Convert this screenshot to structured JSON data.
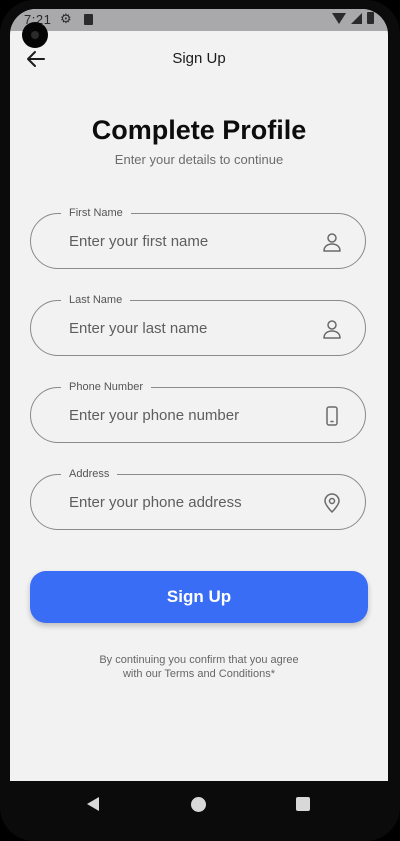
{
  "status_bar": {
    "time": "7:21"
  },
  "app_bar": {
    "title": "Sign Up",
    "back_icon": "arrow-left-icon"
  },
  "header": {
    "title": "Complete Profile",
    "subtitle": "Enter your details to continue"
  },
  "form": {
    "fields": [
      {
        "label": "First Name",
        "value": "",
        "placeholder": "Enter your first name",
        "icon": "person-icon"
      },
      {
        "label": "Last Name",
        "value": "",
        "placeholder": "Enter your last name",
        "icon": "person-icon"
      },
      {
        "label": "Phone Number",
        "value": "",
        "placeholder": "Enter your phone number",
        "icon": "phone-icon"
      },
      {
        "label": "Address",
        "value": "",
        "placeholder": "Enter your phone address",
        "icon": "location-pin-icon"
      }
    ],
    "submit_label": "Sign Up"
  },
  "footer": {
    "terms_line1": "By continuing you confirm that you agree",
    "terms_line2": "with our Terms and Conditions*"
  },
  "colors": {
    "accent": "#3a6df6",
    "background": "#f2f2f3",
    "border": "#8a8a8a"
  }
}
